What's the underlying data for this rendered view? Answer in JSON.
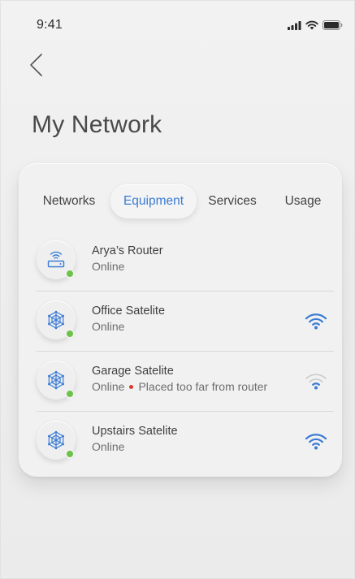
{
  "status_bar": {
    "time": "9:41"
  },
  "header": {
    "title": "My Network"
  },
  "tabs": [
    {
      "label": "Networks",
      "active": false
    },
    {
      "label": "Equipment",
      "active": true
    },
    {
      "label": "Services",
      "active": false
    },
    {
      "label": "Usage",
      "active": false
    }
  ],
  "devices": [
    {
      "name": "Arya’s Router",
      "status": "Online",
      "warning": "",
      "icon": "router-icon",
      "signal": "none"
    },
    {
      "name": "Office Satelite",
      "status": "Online",
      "warning": "",
      "icon": "satellite-mesh-icon",
      "signal": "strong"
    },
    {
      "name": "Garage Satelite",
      "status": "Online",
      "warning": "Placed too far from router",
      "icon": "satellite-mesh-icon",
      "signal": "weak"
    },
    {
      "name": "Upstairs Satelite",
      "status": "Online",
      "warning": "",
      "icon": "satellite-mesh-icon",
      "signal": "strong"
    }
  ],
  "colors": {
    "accent": "#3a7bd5",
    "online": "#6cc24a",
    "warning": "#d63a2f",
    "weak_signal": "#b5b5b5"
  }
}
